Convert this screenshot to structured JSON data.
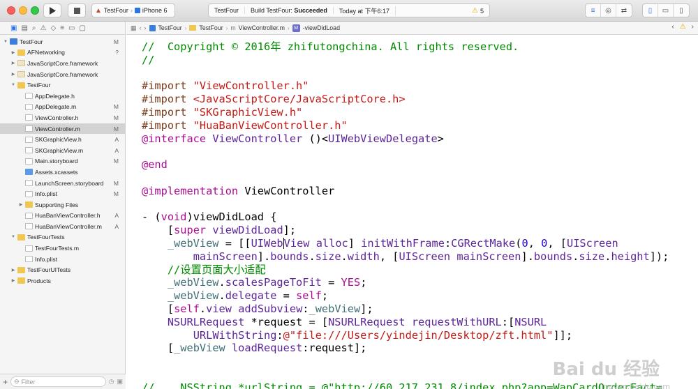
{
  "toolbar": {
    "scheme": "TestFour",
    "device": "iPhone 6",
    "status_project": "TestFour",
    "status_build_prefix": "Build TestFour: ",
    "status_build_result": "Succeeded",
    "status_time": "Today at 下午6:17",
    "warning_count": "5"
  },
  "navigator": {
    "filter_placeholder": "Filter",
    "items": [
      {
        "label": "TestFour",
        "badge": "M",
        "icon": "project-icon",
        "depth": 0,
        "disclosure": "open"
      },
      {
        "label": "AFNetworking",
        "badge": "?",
        "icon": "folder-icon",
        "depth": 1,
        "disclosure": "closed"
      },
      {
        "label": "JavaScriptCore.framework",
        "badge": "",
        "icon": "framework-icon",
        "depth": 1,
        "disclosure": "closed"
      },
      {
        "label": "JavaScriptCore.framework",
        "badge": "",
        "icon": "framework-icon",
        "depth": 1,
        "disclosure": "closed"
      },
      {
        "label": "TestFour",
        "badge": "",
        "icon": "folder-icon",
        "depth": 1,
        "disclosure": "open"
      },
      {
        "label": "AppDelegate.h",
        "badge": "",
        "icon": "header-file-icon",
        "depth": 2,
        "disclosure": ""
      },
      {
        "label": "AppDelegate.m",
        "badge": "M",
        "icon": "source-file-icon",
        "depth": 2,
        "disclosure": ""
      },
      {
        "label": "ViewController.h",
        "badge": "M",
        "icon": "header-file-icon",
        "depth": 2,
        "disclosure": ""
      },
      {
        "label": "ViewController.m",
        "badge": "M",
        "icon": "source-file-icon",
        "depth": 2,
        "disclosure": "",
        "selected": true
      },
      {
        "label": "SKGraphicView.h",
        "badge": "A",
        "icon": "header-file-icon",
        "depth": 2,
        "disclosure": ""
      },
      {
        "label": "SKGraphicView.m",
        "badge": "A",
        "icon": "source-file-icon",
        "depth": 2,
        "disclosure": ""
      },
      {
        "label": "Main.storyboard",
        "badge": "M",
        "icon": "storyboard-icon",
        "depth": 2,
        "disclosure": ""
      },
      {
        "label": "Assets.xcassets",
        "badge": "",
        "icon": "assets-icon",
        "depth": 2,
        "disclosure": ""
      },
      {
        "label": "LaunchScreen.storyboard",
        "badge": "M",
        "icon": "storyboard-icon",
        "depth": 2,
        "disclosure": ""
      },
      {
        "label": "Info.plist",
        "badge": "M",
        "icon": "plist-icon",
        "depth": 2,
        "disclosure": ""
      },
      {
        "label": "Supporting Files",
        "badge": "",
        "icon": "folder-icon",
        "depth": 2,
        "disclosure": "closed"
      },
      {
        "label": "HuaBanViewController.h",
        "badge": "A",
        "icon": "header-file-icon",
        "depth": 2,
        "disclosure": ""
      },
      {
        "label": "HuaBanViewController.m",
        "badge": "A",
        "icon": "source-file-icon",
        "depth": 2,
        "disclosure": ""
      },
      {
        "label": "TestFourTests",
        "badge": "",
        "icon": "folder-icon",
        "depth": 1,
        "disclosure": "open"
      },
      {
        "label": "TestFourTests.m",
        "badge": "",
        "icon": "source-file-icon",
        "depth": 2,
        "disclosure": ""
      },
      {
        "label": "Info.plist",
        "badge": "",
        "icon": "plist-icon",
        "depth": 2,
        "disclosure": ""
      },
      {
        "label": "TestFourUITests",
        "badge": "",
        "icon": "folder-icon",
        "depth": 1,
        "disclosure": "closed"
      },
      {
        "label": "Products",
        "badge": "",
        "icon": "folder-icon",
        "depth": 1,
        "disclosure": "closed"
      }
    ]
  },
  "jumpbar": {
    "project": "TestFour",
    "group": "TestFour",
    "file": "ViewController.m",
    "method_badge": "M",
    "method": "-viewDidLoad"
  },
  "editor": {
    "lines": [
      [
        [
          "c-comment",
          "//  Copyright © 2016年 zhifutongchina. All rights reserved."
        ]
      ],
      [
        [
          "c-comment",
          "//"
        ]
      ],
      [],
      [
        [
          "c-dir",
          "#import "
        ],
        [
          "c-str",
          "\"ViewController.h\""
        ]
      ],
      [
        [
          "c-dir",
          "#import "
        ],
        [
          "c-str",
          "<JavaScriptCore/JavaScriptCore.h>"
        ]
      ],
      [
        [
          "c-dir",
          "#import "
        ],
        [
          "c-str",
          "\"SKGraphicView.h\""
        ]
      ],
      [
        [
          "c-dir",
          "#import "
        ],
        [
          "c-str",
          "\"HuaBanViewController.h\""
        ]
      ],
      [
        [
          "c-kw",
          "@interface "
        ],
        [
          "c-cls",
          "ViewController"
        ],
        [
          "c-plain",
          " ()<"
        ],
        [
          "c-cls",
          "UIWebViewDelegate"
        ],
        [
          "c-plain",
          ">"
        ]
      ],
      [],
      [
        [
          "c-kw",
          "@end"
        ]
      ],
      [],
      [
        [
          "c-kw",
          "@implementation "
        ],
        [
          "c-plain",
          "ViewController"
        ]
      ],
      [],
      [
        [
          "c-plain",
          "- ("
        ],
        [
          "c-kw",
          "void"
        ],
        [
          "c-plain",
          ")viewDidLoad {"
        ]
      ],
      [
        [
          "c-plain",
          "    ["
        ],
        [
          "c-kw",
          "super"
        ],
        [
          "c-plain",
          " "
        ],
        [
          "c-cls",
          "viewDidLoad"
        ],
        [
          "c-plain",
          "];"
        ]
      ],
      [
        [
          "c-plain",
          "    "
        ],
        [
          "c-ivar",
          "_webView"
        ],
        [
          "c-plain",
          " = [["
        ],
        [
          "c-cls",
          "UIWeb"
        ],
        [
          "cursor",
          ""
        ],
        [
          "c-cls",
          "View"
        ],
        [
          "c-plain",
          " "
        ],
        [
          "c-cls",
          "alloc"
        ],
        [
          "c-plain",
          "] "
        ],
        [
          "c-cls",
          "initWithFrame"
        ],
        [
          "c-plain",
          ":"
        ],
        [
          "c-cls",
          "CGRectMake"
        ],
        [
          "c-plain",
          "("
        ],
        [
          "c-num",
          "0"
        ],
        [
          "c-plain",
          ", "
        ],
        [
          "c-num",
          "0"
        ],
        [
          "c-plain",
          ", ["
        ],
        [
          "c-cls",
          "UIScreen"
        ]
      ],
      [
        [
          "c-plain",
          "        "
        ],
        [
          "c-cls",
          "mainScreen"
        ],
        [
          "c-plain",
          "]."
        ],
        [
          "c-cls",
          "bounds"
        ],
        [
          "c-plain",
          "."
        ],
        [
          "c-cls",
          "size"
        ],
        [
          "c-plain",
          "."
        ],
        [
          "c-cls",
          "width"
        ],
        [
          "c-plain",
          ", ["
        ],
        [
          "c-cls",
          "UIScreen"
        ],
        [
          "c-plain",
          " "
        ],
        [
          "c-cls",
          "mainScreen"
        ],
        [
          "c-plain",
          "]."
        ],
        [
          "c-cls",
          "bounds"
        ],
        [
          "c-plain",
          "."
        ],
        [
          "c-cls",
          "size"
        ],
        [
          "c-plain",
          "."
        ],
        [
          "c-cls",
          "height"
        ],
        [
          "c-plain",
          "]);"
        ]
      ],
      [
        [
          "c-comment",
          "    //设置页面大小适配"
        ]
      ],
      [
        [
          "c-plain",
          "    "
        ],
        [
          "c-ivar",
          "_webView"
        ],
        [
          "c-plain",
          "."
        ],
        [
          "c-cls",
          "scalesPageToFit"
        ],
        [
          "c-plain",
          " = "
        ],
        [
          "c-kw",
          "YES"
        ],
        [
          "c-plain",
          ";"
        ]
      ],
      [
        [
          "c-plain",
          "    "
        ],
        [
          "c-ivar",
          "_webView"
        ],
        [
          "c-plain",
          "."
        ],
        [
          "c-cls",
          "delegate"
        ],
        [
          "c-plain",
          " = "
        ],
        [
          "c-kw",
          "self"
        ],
        [
          "c-plain",
          ";"
        ]
      ],
      [
        [
          "c-plain",
          "    ["
        ],
        [
          "c-kw",
          "self"
        ],
        [
          "c-plain",
          "."
        ],
        [
          "c-cls",
          "view"
        ],
        [
          "c-plain",
          " "
        ],
        [
          "c-cls",
          "addSubview"
        ],
        [
          "c-plain",
          ":"
        ],
        [
          "c-ivar",
          "_webView"
        ],
        [
          "c-plain",
          "];"
        ]
      ],
      [
        [
          "c-plain",
          "    "
        ],
        [
          "c-cls",
          "NSURLRequest"
        ],
        [
          "c-plain",
          " *request = ["
        ],
        [
          "c-cls",
          "NSURLRequest"
        ],
        [
          "c-plain",
          " "
        ],
        [
          "c-cls",
          "requestWithURL"
        ],
        [
          "c-plain",
          ":["
        ],
        [
          "c-cls",
          "NSURL"
        ]
      ],
      [
        [
          "c-plain",
          "        "
        ],
        [
          "c-cls",
          "URLWithString"
        ],
        [
          "c-plain",
          ":"
        ],
        [
          "c-str",
          "@\"file:///Users/yindejin/Desktop/zft.html\""
        ],
        [
          "c-plain",
          "]];"
        ]
      ],
      [
        [
          "c-plain",
          "    ["
        ],
        [
          "c-ivar",
          "_webView"
        ],
        [
          "c-plain",
          " "
        ],
        [
          "c-cls",
          "loadRequest"
        ],
        [
          "c-plain",
          ":request];"
        ]
      ],
      [],
      [],
      [
        [
          "c-comment",
          "//    NSString *urlString = @\"http://60.217.231.8/index.php?app=WapCardOrderFact="
        ]
      ]
    ],
    "watermark": "Bai du 经验",
    "watermark_sub": "jingyan.baidu.com"
  }
}
